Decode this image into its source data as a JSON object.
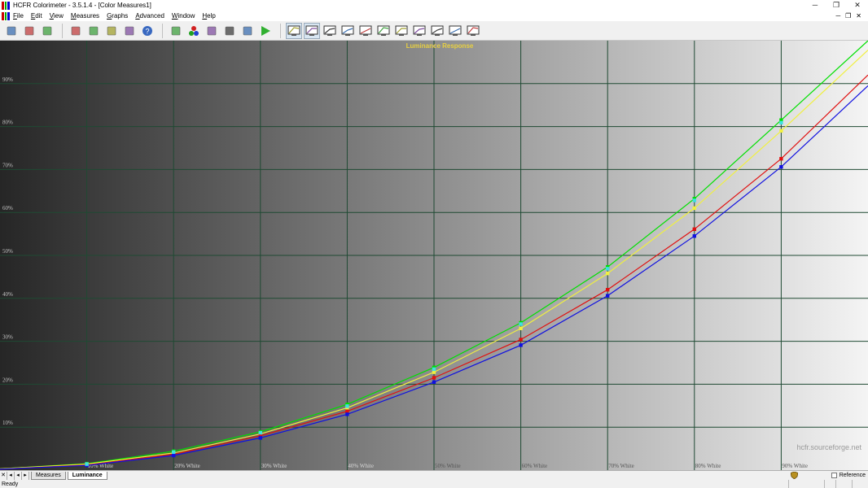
{
  "window": {
    "title": "HCFR Colorimeter - 3.5.1.4 - [Color Measures1]",
    "minimize": "─",
    "restore": "❐",
    "close": "✕"
  },
  "menu": {
    "items": [
      "File",
      "Edit",
      "View",
      "Measures",
      "Graphs",
      "Advanced",
      "Window",
      "Help"
    ],
    "mdi_minimize": "─",
    "mdi_restore": "❐",
    "mdi_close": "✕"
  },
  "toolbar": {
    "groups": [
      [
        "new-icon",
        "open-icon",
        "save-icon"
      ],
      [
        "cut-icon",
        "copy-icon",
        "paste-icon",
        "print-icon",
        "help-icon"
      ],
      [
        "sensor-icon",
        "rgb-dots-icon",
        "colors-icon",
        "patterns-icon",
        "camera-icon",
        "play-icon"
      ],
      [
        "view-1-icon",
        "view-2-icon",
        "view-3-icon",
        "view-4-icon",
        "view-5-icon",
        "view-6-icon",
        "view-7-icon",
        "view-8-icon",
        "view-9-icon",
        "view-10-icon",
        "view-11-icon"
      ]
    ],
    "pressed": [
      "view-1-icon",
      "view-2-icon"
    ]
  },
  "chart_data": {
    "type": "line",
    "title": "Luminance Response",
    "watermark": "hcfr.sourceforge.net",
    "x": [
      0,
      10,
      20,
      30,
      40,
      50,
      60,
      70,
      80,
      90,
      100
    ],
    "x_tick_labels": [
      "10% White",
      "20% White",
      "30% White",
      "40% White",
      "50% White",
      "60% White",
      "70% White",
      "80% White",
      "90% White"
    ],
    "y_tick_labels": [
      "10%",
      "20%",
      "30%",
      "40%",
      "50%",
      "60%",
      "70%",
      "80%",
      "90%"
    ],
    "xlim": [
      0,
      100
    ],
    "ylim": [
      0,
      100
    ],
    "grid": true,
    "series": [
      {
        "color": "#00e000",
        "values": [
          0.3,
          1.5,
          4.4,
          8.9,
          15.3,
          23.9,
          34.3,
          47.3,
          63.2,
          81.5,
          100
        ]
      },
      {
        "color": "#f0f040",
        "values": [
          0.3,
          1.4,
          4.0,
          8.4,
          14.5,
          22.8,
          33.0,
          45.8,
          61.0,
          79.0,
          97.8
        ]
      },
      {
        "color": "#e01010",
        "values": [
          0.2,
          1.2,
          3.7,
          8.0,
          13.7,
          21.5,
          30.4,
          42.0,
          56.1,
          72.5,
          92.0
        ]
      },
      {
        "color": "#1010e0",
        "values": [
          0.2,
          1.1,
          3.4,
          7.5,
          13.0,
          20.5,
          29.1,
          40.6,
          54.5,
          70.6,
          89.5
        ]
      }
    ],
    "reference_marker_color": "#40e0e0",
    "reference_values": [
      0.3,
      1.4,
      4.2,
      8.7,
      14.9,
      23.5,
      34.0,
      46.9,
      62.8,
      80.9
    ]
  },
  "tabs": {
    "items": [
      "Measures",
      "Luminance"
    ],
    "active": "Luminance",
    "nav": [
      "✕",
      "◂",
      "◂",
      "▸"
    ]
  },
  "reference": {
    "label": "Reference"
  },
  "status": {
    "text": "Ready"
  }
}
